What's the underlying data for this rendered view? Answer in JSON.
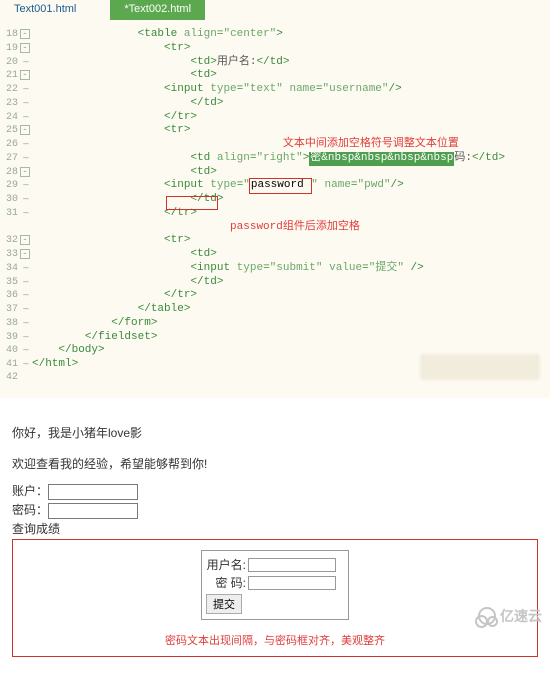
{
  "tabs": {
    "t1": "Text001.html",
    "t2": "*Text002.html"
  },
  "code": {
    "l18": {
      "tag_open": "<table ",
      "attr1": "align",
      "eq": "=",
      "val1": "\"center\"",
      "tag_close": ">"
    },
    "l19": {
      "tr": "<tr>"
    },
    "l20": {
      "td_o": "<td>",
      "txt": "用户名:",
      "td_c": "</td>"
    },
    "l21": {
      "td": "<td>"
    },
    "l22": {
      "input_o": "<input ",
      "a1": "type",
      "v1": "\"text\"",
      "a2": "name",
      "v2": "\"username\"",
      "input_c": "/>"
    },
    "l23": {
      "td_c": "</td>"
    },
    "l24": {
      "tr_c": "</tr>"
    },
    "l25": {
      "tr": "<tr>"
    },
    "l26": {
      "anno": "文本中间添加空格符号调整文本位置"
    },
    "l27": {
      "td_o": "<td ",
      "a1": "align",
      "v1": "\"right\"",
      "close": ">",
      "sel": "密&nbsp&nbsp&nbsp&nbsp",
      "after": "码:",
      "td_c": "</td>"
    },
    "l28": {
      "td": "<td>"
    },
    "l29": {
      "input_o": "<input ",
      "a1": "type",
      "v1_pre": "\"",
      "v1_hl": "password ",
      "v1_post": "\"",
      "a2": "name",
      "v2": "\"pwd\"",
      "input_c": "/>"
    },
    "l30": {
      "td_c": "</td>"
    },
    "l31": {
      "tr_c": "</tr>"
    },
    "l32": {
      "anno": "password组件后添加空格"
    },
    "l32a": {
      "tr": "<tr>"
    },
    "l33": {
      "td": "<td>"
    },
    "l34": {
      "input_o": "<input ",
      "a1": "type",
      "v1": "\"submit\"",
      "a2": "value",
      "v2": "\"提交\"",
      "input_c": " />"
    },
    "l35": {
      "td_c": "</td>"
    },
    "l36": {
      "tr_c": "</tr>"
    },
    "l37": {
      "table_c": "</table>"
    },
    "l38": {
      "form_c": "</form>"
    },
    "l39": {
      "fs_c": "</fieldset>"
    },
    "l40": {
      "body_c": "</body>"
    },
    "l41": {
      "html_c": "</html>"
    }
  },
  "page": {
    "greet": "你好，我是小猪年love影",
    "sub": "欢迎查看我的经验，希望能够帮到你!",
    "side": {
      "acct": "账户：",
      "pwd": "密码：",
      "legend": "查询成绩"
    },
    "form": {
      "user": "用户名:",
      "pwd": "密   码:",
      "submit": "提交"
    },
    "note": "密码文本出现间隔，与密码框对齐，美观整齐"
  },
  "watermark": "亿速云"
}
